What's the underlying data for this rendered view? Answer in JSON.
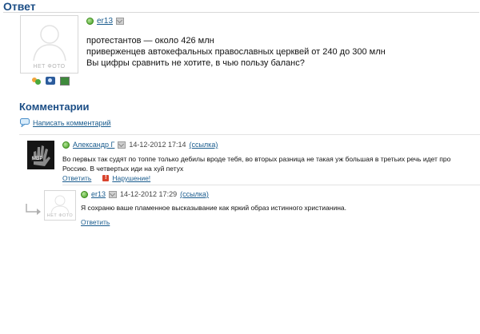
{
  "answer": {
    "heading": "Ответ",
    "author": "er13",
    "nophoto": "НЕТ ФОТО",
    "lines": [
      "протестантов — около 426 млн",
      "приверженцев автокефальных православных церквей от 240 до 300 млн",
      "Вы цифры сравнить не хотите, в чью пользу баланс?"
    ]
  },
  "comments": {
    "heading": "Комментарии",
    "write_link": "Написать комментарий",
    "items": [
      {
        "author": "Александр Г",
        "date": "14-12-2012 17:14",
        "permalink": "(ссылка)",
        "avatar_text": "MBP",
        "text_lines": [
          "Во первых так судят по топпе только дебилы вроде тебя, во вторых разница не такая уж большая в третьих речь идет про",
          "Россию. В четвертых иди на хуй петух"
        ],
        "reply": "Ответить",
        "report": "Нарушение!"
      },
      {
        "author": "er13",
        "date": "14-12-2012 17:29",
        "permalink": "(ссылка)",
        "nophoto": "НЕТ ФОТО",
        "text_lines": [
          "Я сохраню ваше пламенное высказывание как яркий образ истинного христианина."
        ],
        "reply": "Ответить"
      }
    ]
  }
}
